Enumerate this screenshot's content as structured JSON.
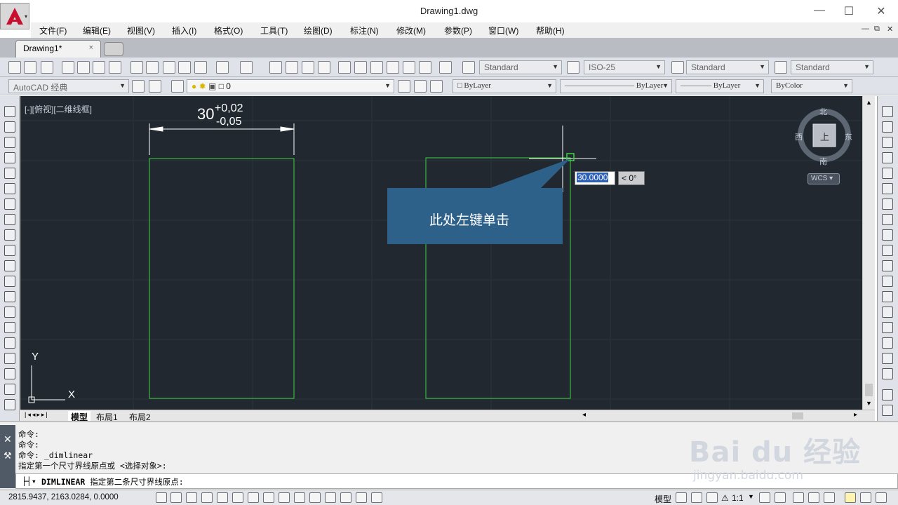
{
  "window": {
    "title": "Drawing1.dwg",
    "minimize_icon": "minimize-icon",
    "maximize_icon": "maximize-icon",
    "close_icon": "close-icon"
  },
  "menu": {
    "items": [
      "文件(F)",
      "编辑(E)",
      "视图(V)",
      "插入(I)",
      "格式(O)",
      "工具(T)",
      "绘图(D)",
      "标注(N)",
      "修改(M)",
      "参数(P)",
      "窗口(W)",
      "帮助(H)"
    ]
  },
  "tabs": {
    "active": "Drawing1*",
    "close": "×"
  },
  "toolbar": {
    "text_style": "Standard",
    "dim_style": "ISO-25",
    "table_style": "Standard",
    "multileader_style": "Standard",
    "workspace": "AutoCAD 经典",
    "layer": "0",
    "color": "ByLayer",
    "linetype": "ByLayer",
    "lineweight": "ByLayer",
    "plotstyle": "ByColor"
  },
  "viewport": {
    "label": "[-][俯视][二维线框]",
    "dimension_base": "30",
    "tol_upper": "+0,02",
    "tol_lower": "-0,05",
    "callout": "此处左键单击",
    "dyn_value": "30.0000",
    "dyn_angle": "< 0°",
    "compass": {
      "n": "北",
      "s": "南",
      "e": "东",
      "w": "西",
      "top": "上"
    },
    "wcs": "WCS",
    "ucs_x": "X",
    "ucs_y": "Y"
  },
  "layout_tabs": [
    "模型",
    "布局1",
    "布局2"
  ],
  "command": {
    "history": [
      "命令:",
      "命令:",
      "命令: _dimlinear",
      "指定第一个尺寸界线原点或 <选择对象>:"
    ],
    "prompt_cmd": "DIMLINEAR",
    "prompt_text": "指定第二条尺寸界线原点:"
  },
  "status": {
    "coords": "2815.9437, 2163.0284, 0.0000",
    "model": "模型",
    "scale": "1:1"
  },
  "watermark": {
    "brand": "Bai du 经验",
    "url": "jingyan.baidu.com"
  },
  "colors": {
    "canvas": "#212830",
    "green": "#3fd23f",
    "callout": "#2e6189"
  }
}
